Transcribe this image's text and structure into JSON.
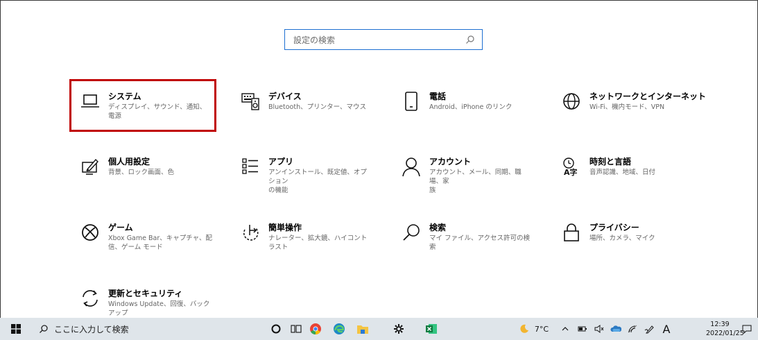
{
  "search": {
    "placeholder": "設定の検索"
  },
  "tiles": [
    {
      "title": "システム",
      "desc": "ディスプレイ、サウンド、通知、電源",
      "icon": "laptop-icon"
    },
    {
      "title": "デバイス",
      "desc": "Bluetooth、プリンター、マウス",
      "icon": "devices-icon"
    },
    {
      "title": "電話",
      "desc": "Android、iPhone のリンク",
      "icon": "phone-icon"
    },
    {
      "title": "ネットワークとインターネット",
      "desc": "Wi-Fi、機内モード、VPN",
      "icon": "globe-icon"
    },
    {
      "title": "個人用設定",
      "desc": "背景、ロック画面、色",
      "icon": "personalization-icon"
    },
    {
      "title": "アプリ",
      "desc": "アンインストール、既定値、オプション\nの機能",
      "icon": "apps-list-icon"
    },
    {
      "title": "アカウント",
      "desc": "アカウント、メール、同期、職場、家\n族",
      "icon": "person-icon"
    },
    {
      "title": "時刻と言語",
      "desc": "音声認識、地域、日付",
      "icon": "time-language-icon"
    },
    {
      "title": "ゲーム",
      "desc": "Xbox Game Bar、キャプチャ、配\n信、ゲーム モード",
      "icon": "xbox-icon"
    },
    {
      "title": "簡単操作",
      "desc": "ナレーター、拡大鏡、ハイコントラスト",
      "icon": "ease-of-access-icon"
    },
    {
      "title": "検索",
      "desc": "マイ ファイル、アクセス許可の検索",
      "icon": "search-icon"
    },
    {
      "title": "プライバシー",
      "desc": "場所、カメラ、マイク",
      "icon": "lock-icon"
    },
    {
      "title": "更新とセキュリティ",
      "desc": "Windows Update、回復、バック\nアップ",
      "icon": "sync-icon"
    }
  ],
  "taskbar": {
    "search_text": "ここに入力して検索",
    "temperature": "7°C",
    "ime": "A",
    "time": "12:39",
    "date": "2022/01/25"
  },
  "colors": {
    "accent": "#1d6fd1",
    "highlight": "#c00000",
    "taskbar": "#dfe5ea"
  }
}
